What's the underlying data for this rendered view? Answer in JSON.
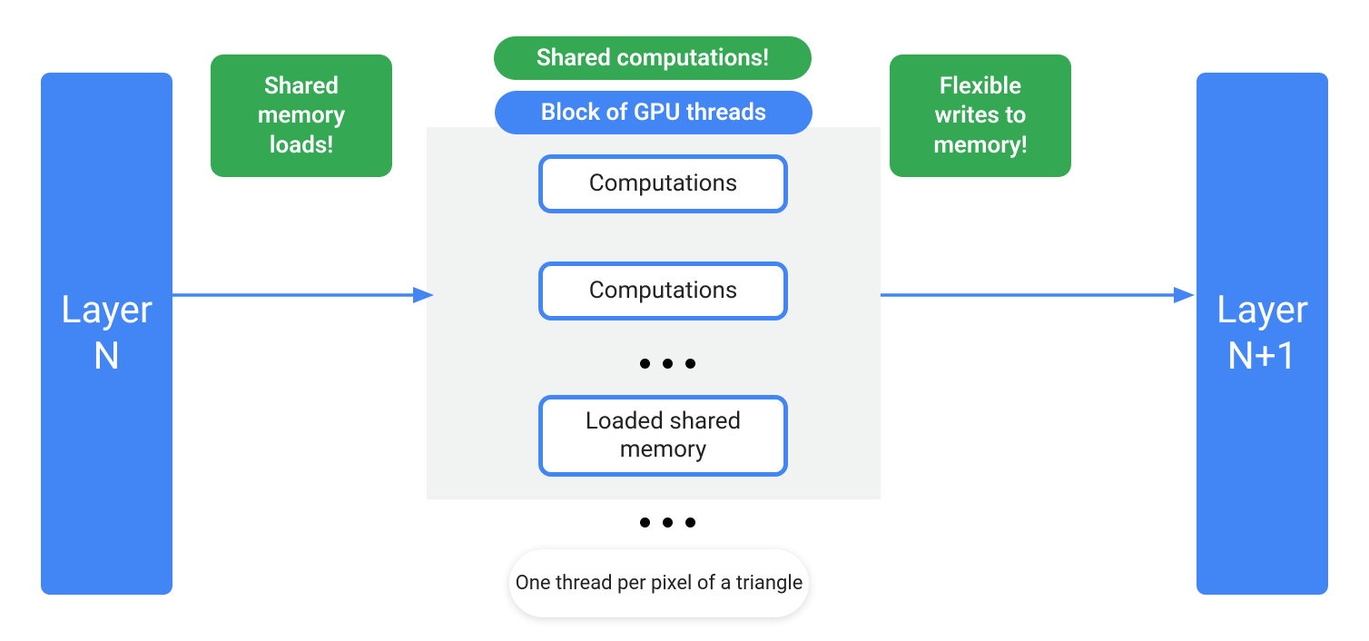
{
  "layers": {
    "left": "Layer\nN",
    "right": "Layer\nN+1"
  },
  "pills": {
    "left": "Shared memory loads!",
    "top": "Shared computations!",
    "right": "Flexible writes to memory!"
  },
  "block_label": "Block of GPU threads",
  "inner_boxes": {
    "b1": "Computations",
    "b2": "Computations",
    "b3": "Loaded shared memory"
  },
  "caption": "One thread per pixel of a triangle",
  "colors": {
    "blue": "#4285f4",
    "green": "#34a853",
    "gray": "#f1f2f2"
  }
}
